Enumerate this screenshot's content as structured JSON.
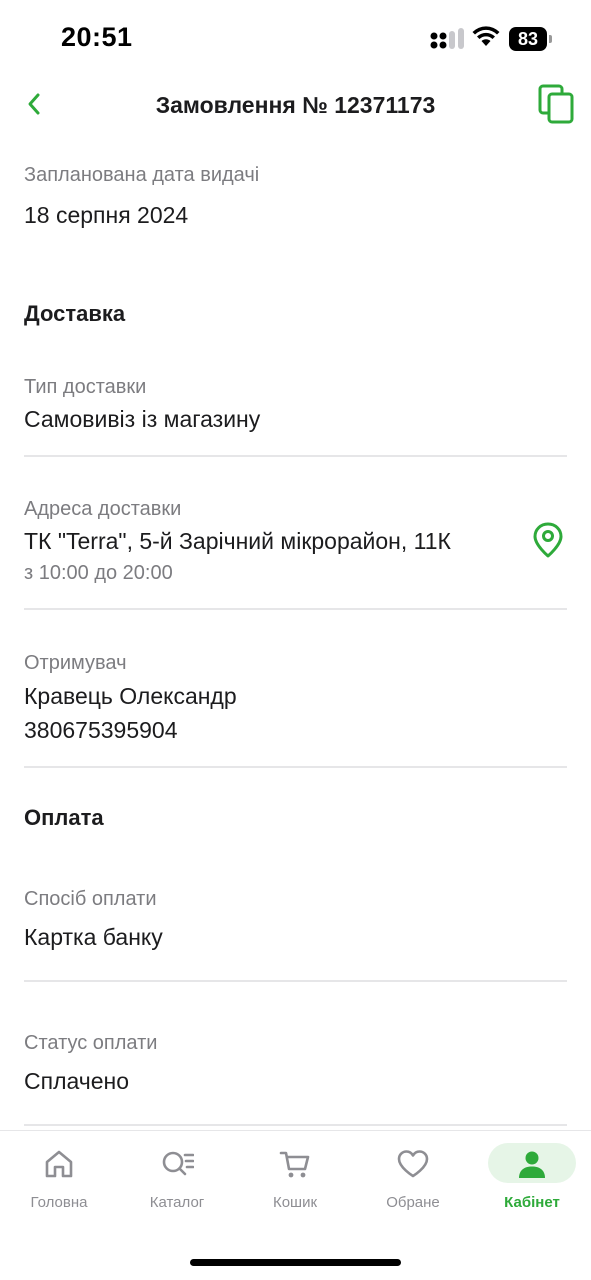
{
  "status_bar": {
    "time": "20:51",
    "battery": "83"
  },
  "header": {
    "title": "Замовлення № 12371173"
  },
  "pickup_date": {
    "label": "Запланована дата видачі",
    "value": "18 серпня 2024"
  },
  "delivery": {
    "section_title": "Доставка",
    "type_label": "Тип доставки",
    "type_value": "Самовивіз із магазину",
    "address_label": "Адреса доставки",
    "address_value": "ТК \"Terra\", 5-й Зарічний мікрорайон, 11К",
    "address_hours": "з 10:00 до 20:00",
    "recipient_label": "Отримувач",
    "recipient_name": "Кравець Олександр",
    "recipient_phone": "380675395904"
  },
  "payment": {
    "section_title": "Оплата",
    "method_label": "Спосіб оплати",
    "method_value": "Картка банку",
    "status_label": "Статус оплати",
    "status_value": "Сплачено"
  },
  "nav": {
    "items": [
      {
        "label": "Головна",
        "icon": "home-icon"
      },
      {
        "label": "Каталог",
        "icon": "catalog-search-icon"
      },
      {
        "label": "Кошик",
        "icon": "cart-icon"
      },
      {
        "label": "Обране",
        "icon": "heart-icon"
      },
      {
        "label": "Кабінет",
        "icon": "user-icon",
        "active": true
      }
    ]
  },
  "colors": {
    "accent": "#2eaa3a",
    "accent_light": "#e6f5e7",
    "text": "#1c1c1e",
    "muted": "#7c7c80",
    "divider": "#e6e6e8"
  }
}
